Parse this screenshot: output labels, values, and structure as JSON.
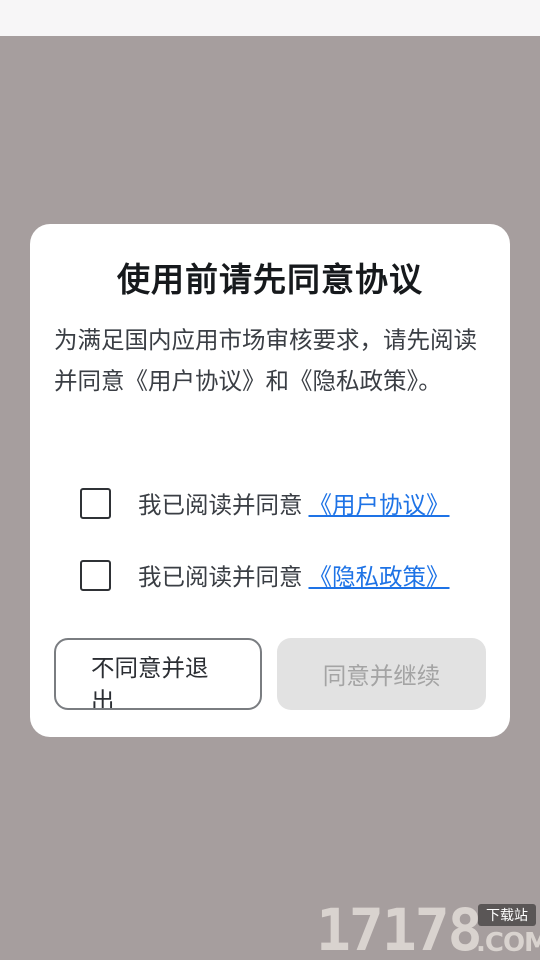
{
  "dialog": {
    "title": "使用前请先同意协议",
    "description": "为满足国内应用市场审核要求，请先阅读并同意《用户协议》和《隐私政策》。",
    "agreements": [
      {
        "text": "我已阅读并同意",
        "link": "《用户协议》",
        "checked": false
      },
      {
        "text": "我已阅读并同意",
        "link": "《隐私政策》",
        "checked": false
      }
    ],
    "disagree_label": "不同意并退出",
    "agree_label": "同意并继续"
  },
  "watermark": {
    "number": "17178",
    "badge": "下载站",
    "domain": ".COM"
  },
  "colors": {
    "overlay": "#a69e9e",
    "link": "#1e73e6",
    "disabled_button": "#e2e2e2"
  }
}
